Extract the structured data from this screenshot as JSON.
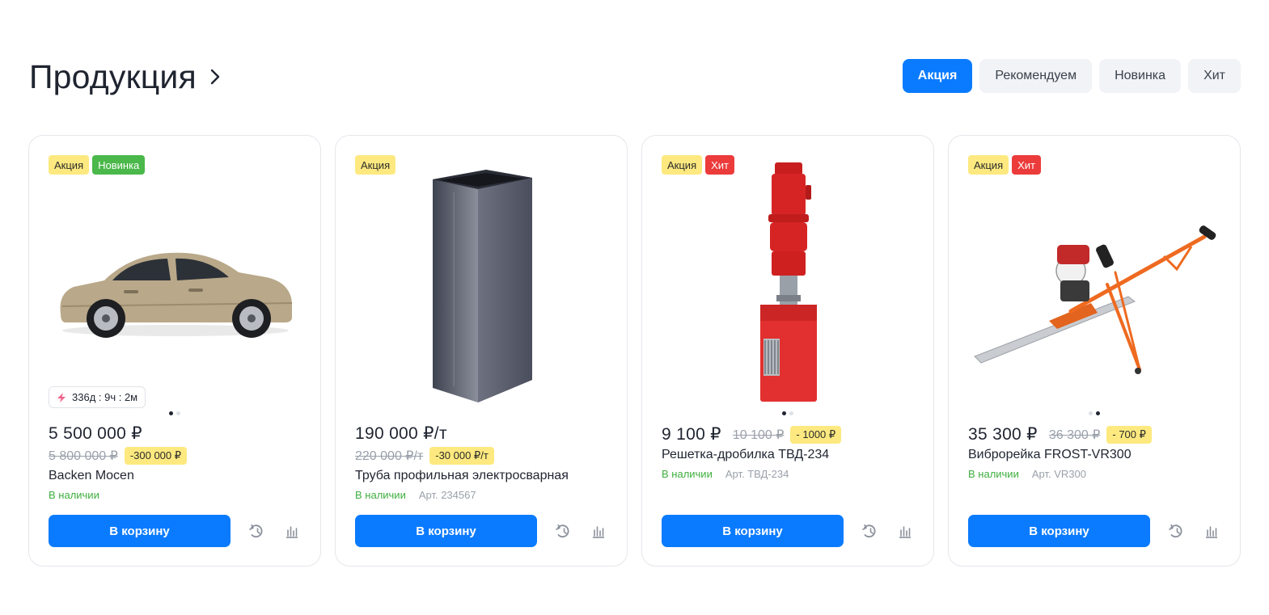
{
  "section": {
    "title": "Продукция"
  },
  "tabs": [
    {
      "label": "Акция",
      "active": true
    },
    {
      "label": "Рекомендуем",
      "active": false
    },
    {
      "label": "Новинка",
      "active": false
    },
    {
      "label": "Хит",
      "active": false
    }
  ],
  "colors": {
    "accent": "#0a7bff",
    "sale_badge": "#fde97f",
    "new_badge": "#4ab84a",
    "hit_badge": "#ec3b3b",
    "in_stock": "#3fae3f"
  },
  "products": [
    {
      "badges": [
        "Акция",
        "Новинка"
      ],
      "image_icon": "car-icon",
      "timer": "336д : 9ч : 2м",
      "price": "5 500 000 ₽",
      "old_price": "5 800 000 ₽",
      "discount": "-300 000 ₽",
      "name": "Backen Mocen",
      "stock": "В наличии",
      "sku": "",
      "cart_label": "В корзину"
    },
    {
      "badges": [
        "Акция"
      ],
      "image_icon": "steel-pipe-icon",
      "price": "190 000 ₽/т",
      "old_price": "220 000 ₽/т",
      "discount": "-30 000 ₽/т",
      "name": "Труба профильная электросварная",
      "stock": "В наличии",
      "sku": "Арт. 234567",
      "cart_label": "В корзину"
    },
    {
      "badges": [
        "Акция",
        "Хит"
      ],
      "image_icon": "crusher-icon",
      "price": "9 100 ₽",
      "old_price": "10 100 ₽",
      "discount": "- 1000 ₽",
      "name": "Решетка-дробилка ТВД-234",
      "stock": "В наличии",
      "sku": "Арт. ТВД-234",
      "cart_label": "В корзину"
    },
    {
      "badges": [
        "Акция",
        "Хит"
      ],
      "image_icon": "vibro-screed-icon",
      "price": "35 300 ₽",
      "old_price": "36 300 ₽",
      "discount": "- 700 ₽",
      "name": "Виброрейка FROST-VR300",
      "stock": "В наличии",
      "sku": "Арт. VR300",
      "cart_label": "В корзину"
    }
  ]
}
